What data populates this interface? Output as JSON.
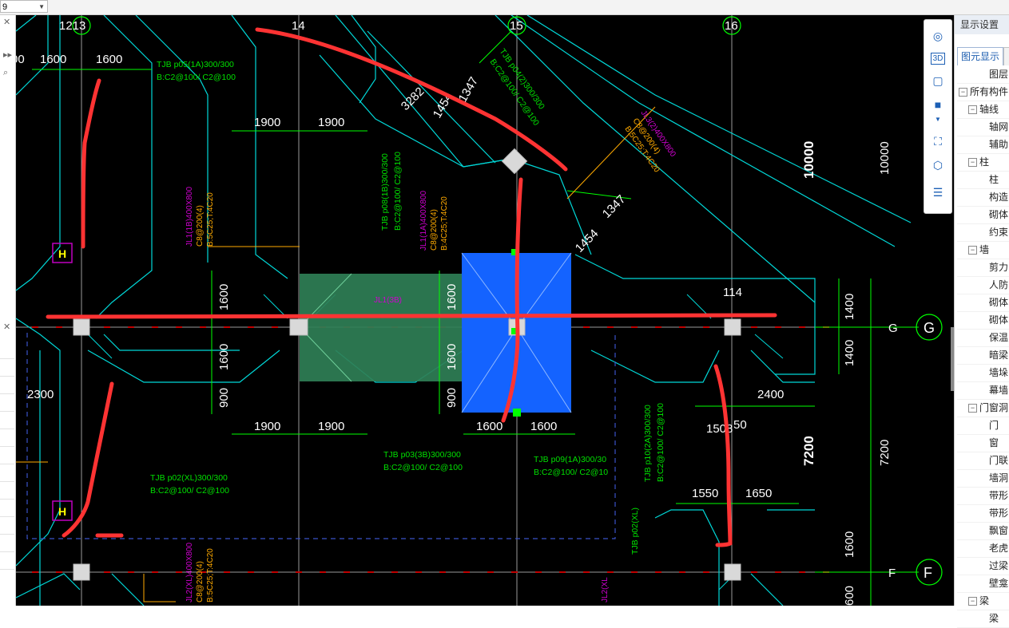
{
  "top_combo": {
    "value": "9"
  },
  "drawing": {
    "axes": {
      "a1213": "1213",
      "a14": "14",
      "a15": "15",
      "a16": "16",
      "G": "G",
      "F": "F"
    },
    "dims": {
      "d1600a": "1600",
      "d1600b": "1600",
      "d1900a": "1900",
      "d1900b": "1900",
      "d3282": "3282",
      "d1347a": "1347",
      "d1454a": "1454",
      "d1347b": "1347",
      "d1454b": "1454",
      "d10000a": "10000",
      "d10000b": "10000",
      "d1600v1": "1600",
      "d1600v2": "1600",
      "d900v1": "900",
      "d1600v3": "1600",
      "d1600v4": "1600",
      "d900v2": "900",
      "d1900c": "1900",
      "d1900d": "1900",
      "d1600c": "1600",
      "d1600d": "1600",
      "d1400a": "1400",
      "d1400b": "1400",
      "d114": "114",
      "d2300": "2300",
      "d2400": "2400",
      "d1508": "1508",
      "d50": "50",
      "d7200a": "7200",
      "d7200b": "7200",
      "d1550": "1550",
      "d1650": "1650",
      "d1600v5": "1600",
      "d600": "600",
      "d00": "00"
    },
    "labels": {
      "tjb05_l1": "TJB  p05(1A)300/300",
      "tjb05_l2": "B:C2@100/   C2@100",
      "tjb04_l1": "TJB  p04(2)300/300",
      "tjb04_l2": "B:C2@100/   C2@100",
      "tjb08_l1": "TJB  p08(1B)300/300",
      "tjb08_l2": "B:C2@100/   C2@100",
      "jl1b_l1": "JL1(1B)400X800",
      "jl1b_l2": "C8@200(4)",
      "jl1b_l3": "B:5C25;T:4C20",
      "jl1a_l1": "JL1(1A)400X800",
      "jl1a_l2": "C8@200(4)",
      "jl1a_l3": "B:4C25;T:4C20",
      "jl3_l1": "JL3(2)400X800",
      "jl3_l2": "C8@200(4)",
      "jl3_l3": "B:5C25;T:4C20",
      "jl1_3b": "JL1(3B)",
      "tjb03_l1": "TJB  p03(3B)300/300",
      "tjb03_l2": "B:C2@100/   C2@100",
      "tjb09_l1": "TJB  p09(1A)300/30",
      "tjb09_l2": "B:C2@100/   C2@10",
      "tjb10_l1": "TJB  p10(2A)300/300",
      "tjb10_l2": "B:C2@100/   C2@100",
      "tjb02_l1": "TJB  p02(XL)300/300",
      "tjb02_l2": "B:C2@100/   C2@100",
      "tjb02b": "TJB  p02(XL)",
      "jl2_l1": "JL2(XL)400X800",
      "jl2_l2": "C8@200(4)",
      "jl2_l3": "B:5C25;T:4C20",
      "jl2b": "JL2(XL"
    }
  },
  "toolbox": {
    "icons": [
      "orbit-icon",
      "view-3d-icon",
      "cube-outline-icon",
      "cube-solid-icon",
      "fullscreen-icon",
      "component-cube-icon",
      "display-settings-icon"
    ]
  },
  "panel": {
    "title": "显示设置",
    "tab_active": "图元显示",
    "tree": [
      {
        "label": "图层",
        "indent": 2,
        "toggle": ""
      },
      {
        "label": "所有构件",
        "indent": 0,
        "toggle": "−"
      },
      {
        "label": "轴线",
        "indent": 1,
        "toggle": "−"
      },
      {
        "label": "轴网",
        "indent": 2,
        "toggle": ""
      },
      {
        "label": "辅助",
        "indent": 2,
        "toggle": ""
      },
      {
        "label": "柱",
        "indent": 1,
        "toggle": "−"
      },
      {
        "label": "柱",
        "indent": 2,
        "toggle": ""
      },
      {
        "label": "构造",
        "indent": 2,
        "toggle": ""
      },
      {
        "label": "砌体",
        "indent": 2,
        "toggle": ""
      },
      {
        "label": "约束",
        "indent": 2,
        "toggle": ""
      },
      {
        "label": "墙",
        "indent": 1,
        "toggle": "−"
      },
      {
        "label": "剪力",
        "indent": 2,
        "toggle": ""
      },
      {
        "label": "人防",
        "indent": 2,
        "toggle": ""
      },
      {
        "label": "砌体",
        "indent": 2,
        "toggle": ""
      },
      {
        "label": "砌体",
        "indent": 2,
        "toggle": ""
      },
      {
        "label": "保温",
        "indent": 2,
        "toggle": ""
      },
      {
        "label": "暗梁",
        "indent": 2,
        "toggle": ""
      },
      {
        "label": "墙垛",
        "indent": 2,
        "toggle": ""
      },
      {
        "label": "幕墙",
        "indent": 2,
        "toggle": ""
      },
      {
        "label": "门窗洞",
        "indent": 1,
        "toggle": "−"
      },
      {
        "label": "门",
        "indent": 2,
        "toggle": ""
      },
      {
        "label": "窗",
        "indent": 2,
        "toggle": ""
      },
      {
        "label": "门联",
        "indent": 2,
        "toggle": ""
      },
      {
        "label": "墙洞",
        "indent": 2,
        "toggle": ""
      },
      {
        "label": "带形",
        "indent": 2,
        "toggle": ""
      },
      {
        "label": "带形",
        "indent": 2,
        "toggle": ""
      },
      {
        "label": "飘窗",
        "indent": 2,
        "toggle": ""
      },
      {
        "label": "老虎",
        "indent": 2,
        "toggle": ""
      },
      {
        "label": "过梁",
        "indent": 2,
        "toggle": ""
      },
      {
        "label": "壁龛",
        "indent": 2,
        "toggle": ""
      },
      {
        "label": "梁",
        "indent": 1,
        "toggle": "−"
      },
      {
        "label": "梁",
        "indent": 2,
        "toggle": ""
      }
    ]
  },
  "colors": {
    "canvas_bg": "#000000",
    "axis_text": "#ffffff",
    "grid_line": "#9a9a9a",
    "outline": "#00e0e0",
    "dimension": "#00ff00",
    "beam_label": "#d000d0",
    "annotation_red": "#ff3333",
    "selected_blue": "#1463ff",
    "selected_green": "#2f7f56"
  }
}
